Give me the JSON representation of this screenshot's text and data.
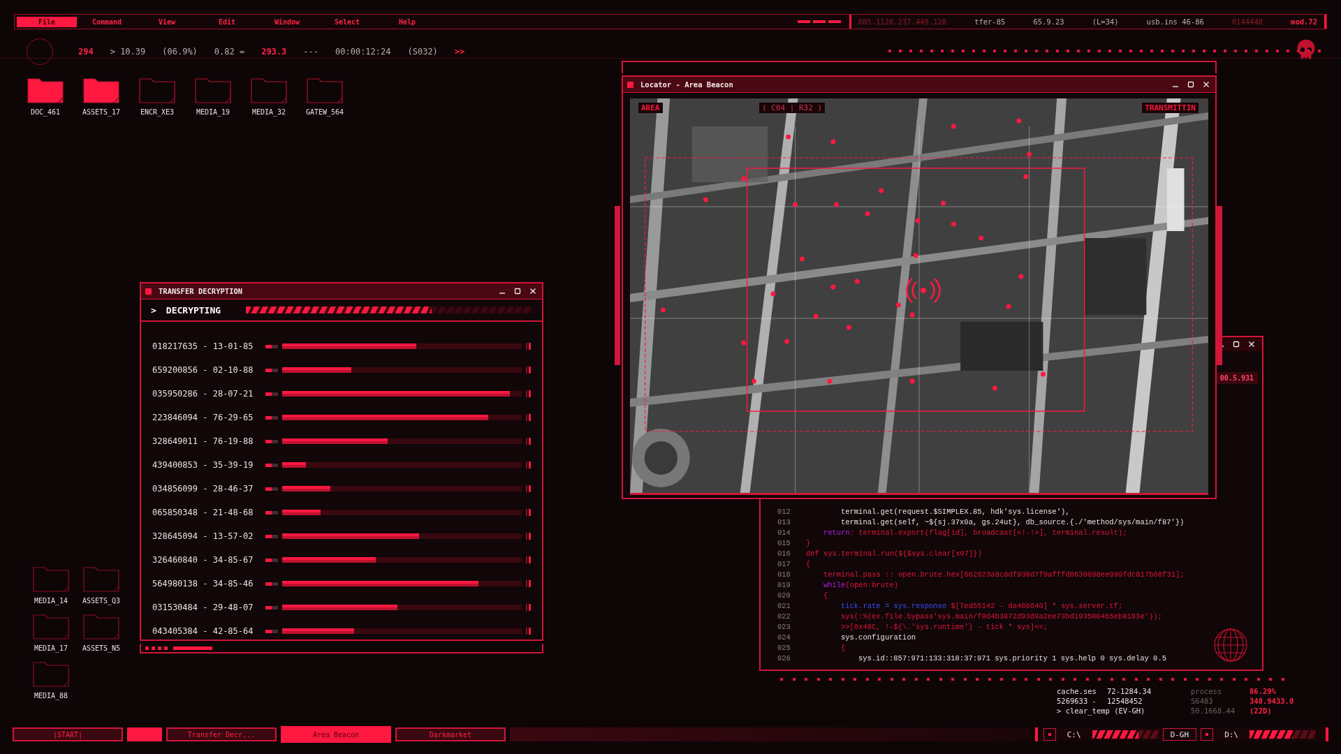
{
  "menu": [
    {
      "label": "File",
      "selected": true
    },
    {
      "label": "Command",
      "selected": false
    },
    {
      "label": "View",
      "selected": false
    },
    {
      "label": "Edit",
      "selected": false
    },
    {
      "label": "Window",
      "selected": false
    },
    {
      "label": "Select",
      "selected": false
    },
    {
      "label": "Help",
      "selected": false
    }
  ],
  "status_segments": [
    {
      "text": "085.1128.237.449.128",
      "kind": "dim"
    },
    {
      "text": "tfer-85",
      "kind": "plain"
    },
    {
      "text": "65.9.23",
      "kind": "plain"
    },
    {
      "text": "(L=34)",
      "kind": "plain"
    },
    {
      "text": "usb.ins 46-86",
      "kind": "plain"
    },
    {
      "text": "0144448",
      "kind": "dim"
    },
    {
      "text": "mod.72",
      "kind": "accent"
    }
  ],
  "readout": [
    {
      "text": "294",
      "kind": "accent"
    },
    {
      "text": "> 10.39",
      "kind": "plain"
    },
    {
      "text": "(06.9%)",
      "kind": "plain"
    },
    {
      "text": "0.82 =",
      "kind": "plain"
    },
    {
      "text": "293.3",
      "kind": "accent"
    },
    {
      "text": "---",
      "kind": "plain"
    },
    {
      "text": "00:00:12:24",
      "kind": "plain"
    },
    {
      "text": "(S032)",
      "kind": "plain"
    },
    {
      "text": ">>",
      "kind": "accent"
    }
  ],
  "desktop_icons": [
    {
      "label": "DOC_461",
      "selected": true
    },
    {
      "label": "ASSETS_17",
      "selected": true
    },
    {
      "label": "ENCR_XE3",
      "selected": false
    },
    {
      "label": "MEDIA_19",
      "selected": false
    },
    {
      "label": "MEDIA_32",
      "selected": false
    },
    {
      "label": "GATEW_564",
      "selected": false
    }
  ],
  "lower_icons": [
    {
      "label": "MEDIA_14",
      "selected": false
    },
    {
      "label": "ASSETS_Q3",
      "selected": false
    },
    {
      "label": "MEDIA_17",
      "selected": false
    },
    {
      "label": "ASSETS_N5",
      "selected": false
    },
    {
      "label": "MEDIA_88",
      "selected": false
    }
  ],
  "decryption": {
    "title": "TRANSFER DECRYPTION",
    "prompt": ">",
    "status": "DECRYPTING",
    "level": 0.65,
    "rows": [
      {
        "label": "018217635 - 13-01-85",
        "level": 0.56
      },
      {
        "label": "659200856 - 02-10-88",
        "level": 0.29
      },
      {
        "label": "035950286 - 28-07-21",
        "level": 0.95
      },
      {
        "label": "223846094 - 76-29-65",
        "level": 0.86
      },
      {
        "label": "328649011 - 76-19-88",
        "level": 0.44
      },
      {
        "label": "439400853 - 35-39-19",
        "level": 0.1
      },
      {
        "label": "034856099 - 28-46-37",
        "level": 0.2
      },
      {
        "label": "065850348 - 21-48-68",
        "level": 0.16
      },
      {
        "label": "328645094 - 13-57-02",
        "level": 0.57
      },
      {
        "label": "326460840 - 34-85-67",
        "level": 0.39
      },
      {
        "label": "564980138 - 34-85-46",
        "level": 0.82
      },
      {
        "label": "031530484 - 29-48-07",
        "level": 0.48
      },
      {
        "label": "043405384 - 42-85-64",
        "level": 0.3
      }
    ]
  },
  "map": {
    "title": "Locator - Area Beacon",
    "area_label": "AREA",
    "cell_label": "( C04 | R32 )",
    "signal_label": "TRANSMITTIN"
  },
  "code": {
    "badge": "00.5.931",
    "lines": [
      {
        "number": "012",
        "kind": "deep",
        "segments": [
          {
            "text": "terminal.get(request.$SIMPLEX.85, hdk'sys.license'),",
            "kind": "plain"
          }
        ]
      },
      {
        "number": "013",
        "kind": "deep",
        "segments": [
          {
            "text": "terminal.get(self, ~${sj.37x0a, gs.24ut}, db_source.{./'method/sys/main/f87'})",
            "kind": "plain"
          }
        ]
      },
      {
        "number": "014",
        "kind": "inner",
        "segments": [
          {
            "text": "return",
            "kind": "keyword"
          },
          {
            "text": ": terminal.export(flag[id], broadcast[<!-!>], terminal.result);",
            "kind": "red"
          }
        ]
      },
      {
        "number": "015",
        "kind": "top",
        "segments": [
          {
            "text": "}",
            "kind": "red"
          }
        ]
      },
      {
        "number": "016",
        "kind": "top",
        "segments": [
          {
            "text": "def sys.terminal.run(${$sys.clear[x07]})",
            "kind": "red"
          }
        ]
      },
      {
        "number": "017",
        "kind": "top",
        "segments": [
          {
            "text": "{",
            "kind": "red"
          }
        ]
      },
      {
        "number": "018",
        "kind": "inner",
        "segments": [
          {
            "text": "terminal.pass :: open.brute.hex[662023a8c8df938d7f9afffd8630898ee999fdc817b68f31];",
            "kind": "red"
          }
        ]
      },
      {
        "number": "019",
        "kind": "inner",
        "segments": [
          {
            "text": "while",
            "kind": "keyword"
          },
          {
            "text": "(open.brute)",
            "kind": "red"
          }
        ]
      },
      {
        "number": "020",
        "kind": "inner",
        "segments": [
          {
            "text": "{",
            "kind": "red"
          }
        ]
      },
      {
        "number": "021",
        "kind": "deep",
        "segments": [
          {
            "text": "tick.rate = sys.response",
            "kind": "blue"
          },
          {
            "text": " $[7ed55142 - da466640] * sys.server.tf;",
            "kind": "red"
          }
        ]
      },
      {
        "number": "022",
        "kind": "deep",
        "segments": [
          {
            "text": "sys(:%(ex.file.bypass'sys.main/f0d4b3872d93d9a2ee73bd193500465eb8183e'));",
            "kind": "red"
          }
        ]
      },
      {
        "number": "023",
        "kind": "deep",
        "segments": [
          {
            "text": ">>[0x48C, !-${\\.'sys.runtime'} - tick * sys]<<;",
            "kind": "red"
          }
        ]
      },
      {
        "number": "024",
        "kind": "deep",
        "segments": [
          {
            "text": "sys.configuration",
            "kind": "plain"
          }
        ]
      },
      {
        "number": "025",
        "kind": "deep",
        "segments": [
          {
            "text": "{",
            "kind": "red"
          }
        ]
      },
      {
        "number": "026",
        "kind": "deeper",
        "segments": [
          {
            "text": "sys.id::857:971:133:318:37:971 sys.priority 1 sys.help 0 sys.delay 0.5",
            "kind": "plain"
          }
        ]
      }
    ]
  },
  "stats": [
    [
      {
        "text": "cache.ses",
        "kind": "plain"
      },
      {
        "text": "72-1284.34",
        "kind": "plain"
      },
      {
        "text": "process",
        "kind": "dim"
      },
      {
        "text": "86.29%",
        "kind": "accent"
      }
    ],
    [
      {
        "text": "5269633 -",
        "kind": "plain"
      },
      {
        "text": "12548452",
        "kind": "plain"
      },
      {
        "text": "S6483",
        "kind": "dim"
      },
      {
        "text": "348.9433.0",
        "kind": "accent"
      }
    ],
    [
      {
        "text": "> clear_temp (EV-GH)",
        "kind": "plain"
      },
      {
        "text": "50.1668.44",
        "kind": "dim"
      },
      {
        "text": "(22D)",
        "kind": "accent"
      }
    ]
  ],
  "taskbar": [
    {
      "label": "|START|",
      "selected": false
    },
    {
      "label": "Transfer Decr...",
      "selected": false
    },
    {
      "label": "Area Beacon",
      "selected": true
    },
    {
      "label": "Darkmarket",
      "selected": false
    }
  ],
  "drives": [
    {
      "label": "C:\\",
      "level": 0.7
    },
    {
      "label": "D-GH"
    },
    {
      "label": "D:\\",
      "level": 0.65
    }
  ]
}
